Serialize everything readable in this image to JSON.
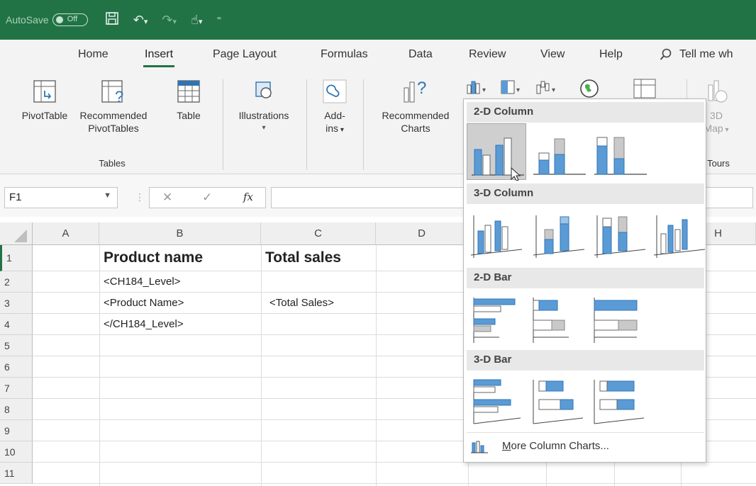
{
  "titlebar": {
    "autosave_label": "AutoSave",
    "autosave_state": "Off",
    "quick_access": [
      "save-icon",
      "undo-icon",
      "redo-icon",
      "touch-mode-icon",
      "customize-icon"
    ]
  },
  "ribbon_tabs": [
    {
      "label": "Home",
      "active": false
    },
    {
      "label": "Insert",
      "active": true
    },
    {
      "label": "Page Layout",
      "active": false
    },
    {
      "label": "Formulas",
      "active": false
    },
    {
      "label": "Data",
      "active": false
    },
    {
      "label": "Review",
      "active": false
    },
    {
      "label": "View",
      "active": false
    },
    {
      "label": "Help",
      "active": false
    }
  ],
  "tell_me": "Tell me wh",
  "ribbon": {
    "pivottable": "PivotTable",
    "recommended_pivot_1": "Recommended",
    "recommended_pivot_2": "PivotTables",
    "table": "Table",
    "tables_group": "Tables",
    "illustrations": "Illustrations",
    "addins_1": "Add-",
    "addins_2": "ins",
    "recommended_charts_1": "Recommended",
    "recommended_charts_2": "Charts",
    "map3d_1": "3D",
    "map3d_2": "Map",
    "tours_group": "Tours"
  },
  "formula_bar": {
    "name_box": "F1",
    "fx": "fx",
    "cancel": "✕",
    "enter": "✓"
  },
  "columns": [
    "A",
    "B",
    "C",
    "D",
    "H"
  ],
  "rows": [
    "1",
    "2",
    "3",
    "4",
    "5",
    "6",
    "7",
    "8",
    "9",
    "10",
    "11"
  ],
  "cells": {
    "B1": "Product name",
    "C1": "Total sales",
    "B2": "<CH184_Level>",
    "B3": "<Product Name>",
    "C3": "<Total Sales>",
    "B4": "</CH184_Level>"
  },
  "gallery": {
    "section_2d_column": "2-D Column",
    "section_3d_column": "3-D Column",
    "section_2d_bar": "2-D Bar",
    "section_3d_bar": "3-D Bar",
    "more_link": "More Column Charts...",
    "accent_blue": "#5b9bd5",
    "accent_gray": "#c9c9c9"
  }
}
